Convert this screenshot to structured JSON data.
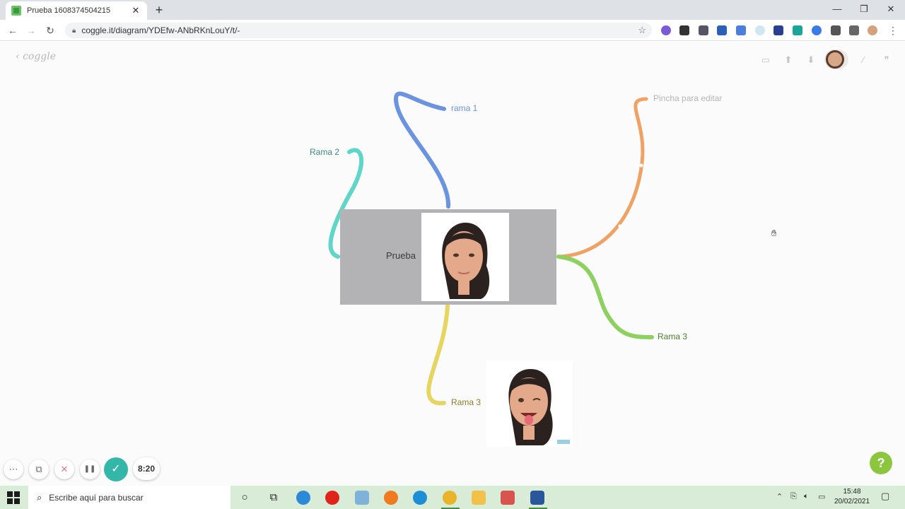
{
  "browser": {
    "tab_title": "Prueba 1608374504215",
    "tab_close": "✕",
    "new_tab": "+",
    "url": "coggle.it/diagram/YDEfw-ANbRKnLouY/t/-",
    "window": {
      "minimize": "—",
      "maximize": "❐",
      "close": "✕"
    }
  },
  "app": {
    "logo": "coggle",
    "back": "‹",
    "toolbar": {
      "present": "▭",
      "upload": "⬆",
      "download": "⬇",
      "line": "⁄",
      "comment": "❞"
    }
  },
  "map": {
    "root_label": "Prueba",
    "branches": [
      {
        "label": "rama 1",
        "color": "#6b93df"
      },
      {
        "label": "Rama 2",
        "color": "#5fd6c7"
      },
      {
        "label": "Pincha para editar",
        "color": "#f0a264"
      },
      {
        "label": "Rama 3",
        "color": "#8fd160"
      },
      {
        "label": "Rama 3",
        "color": "#e6d560"
      }
    ]
  },
  "recorder": {
    "more": "⋯",
    "webcam": "⧉",
    "cancel": "✕",
    "pause": "❚❚",
    "done": "✓",
    "time": "8:20"
  },
  "help": "?",
  "taskbar": {
    "search_placeholder": "Escribe aquí para buscar",
    "time": "15:48",
    "date": "20/02/2021"
  }
}
